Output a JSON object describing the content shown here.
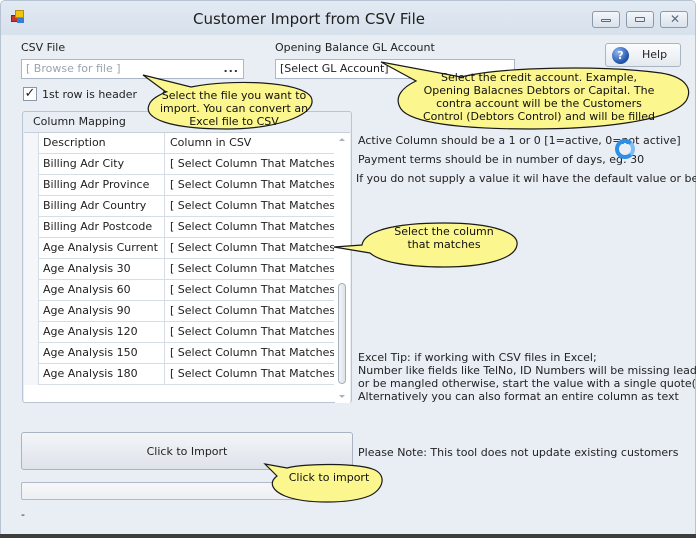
{
  "window": {
    "title": "Customer Import from CSV File",
    "icon": "app-icon",
    "controls": [
      "minimize-icon",
      "maximize-icon",
      "close-icon"
    ]
  },
  "csv_file": {
    "label": "CSV File",
    "placeholder": "[ Browse for file ]",
    "browse_label": "..."
  },
  "gl_account": {
    "label": "Opening Balance GL Account",
    "value": "[Select GL Account]"
  },
  "help_button": {
    "label": "Help",
    "icon": "question-icon"
  },
  "header_checkbox": {
    "label": "1st row is header",
    "checked": true,
    "glyph": "✓"
  },
  "column_mapping": {
    "title": "Column Mapping",
    "columns": [
      "Description",
      "Column in CSV"
    ],
    "rows": [
      {
        "description": "Billing Adr City",
        "column": "[ Select Column That Matches ]"
      },
      {
        "description": "Billing Adr Province",
        "column": "[ Select Column That Matches ]"
      },
      {
        "description": "Billing Adr Country",
        "column": "[ Select Column That Matches ]"
      },
      {
        "description": "Billing Adr Postcode",
        "column": "[ Select Column That Matches ]"
      },
      {
        "description": "Age Analysis Current",
        "column": "[ Select Column That Matches ]"
      },
      {
        "description": "Age Analysis 30",
        "column": "[ Select Column That Matches ]"
      },
      {
        "description": "Age Analysis 60",
        "column": "[ Select Column That Matches ]"
      },
      {
        "description": "Age Analysis 90",
        "column": "[ Select Column That Matches ]"
      },
      {
        "description": "Age Analysis 120",
        "column": "[ Select Column That Matches ]"
      },
      {
        "description": "Age Analysis 150",
        "column": "[ Select Column That Matches ]"
      },
      {
        "description": "Age Analysis 180",
        "column": "[ Select Column That Matches ]"
      }
    ]
  },
  "info": {
    "active_column": "Active Column should be a 1 or 0  [1=active, 0=not active]",
    "payment_terms": "Payment terms should be in number of days, eg: 30",
    "default_value": "If you do not supply a value it wil have the default value or be blank",
    "excel_tip": [
      "Excel Tip: if working with CSV files in Excel;",
      "Number like fields like TelNo, ID Numbers will be missing leading zeros",
      "or be mangled otherwise, start the value with a single quote(')",
      "Alternatively you can also format an entire column as text"
    ],
    "note": "Please Note: This tool does not update existing customers"
  },
  "import_button": {
    "label": "Click to Import"
  },
  "progress": {
    "value": 0
  },
  "status_text": "-",
  "callouts": {
    "file": [
      "Select the file you want to",
      "import. You can convert an",
      "Excel file to CSV"
    ],
    "account": [
      "Select the credit account. Example,",
      "Opening Balacnes Debtors or Capital. The",
      "contra account will be the Customers",
      "Control (Debtors Control) and will be filled"
    ],
    "column": [
      "Select the column",
      "that matches"
    ],
    "import": [
      "Click to import"
    ]
  },
  "colors": {
    "window_bg": "#e9eef5",
    "callout_fill": "#fbf68d",
    "spinner": "#2f8fe6"
  }
}
